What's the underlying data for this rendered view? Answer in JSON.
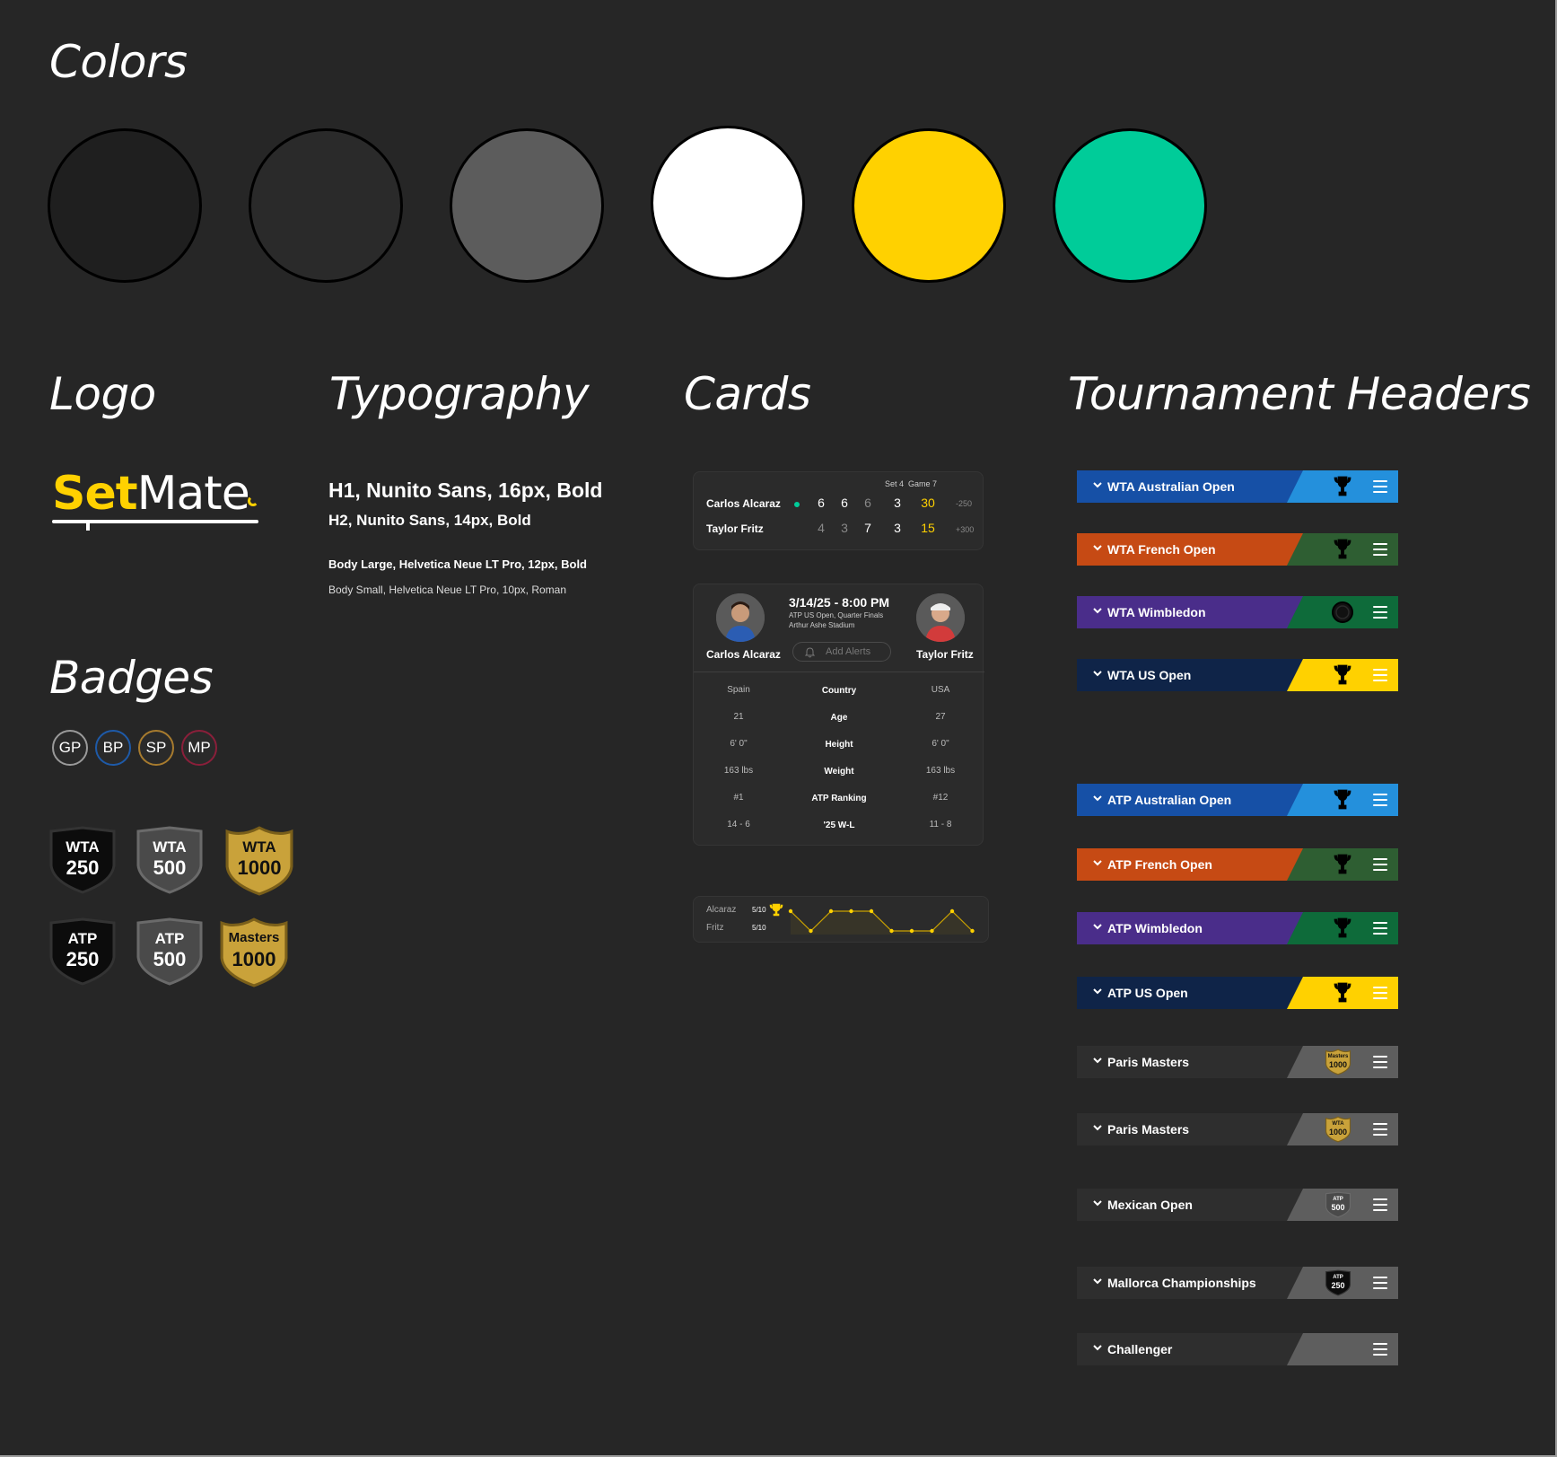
{
  "sections": {
    "colors": "Colors",
    "logo": "Logo",
    "typography": "Typography",
    "cards": "Cards",
    "tournament_headers": "Tournament Headers",
    "badges": "Badges"
  },
  "colors": [
    "#1f1f1f",
    "#2a2a2a",
    "#5c5c5c",
    "#ffffff",
    "#ffd100",
    "#00cc99"
  ],
  "logo": {
    "part1": "Set",
    "part2": "Mate"
  },
  "typography": {
    "h1": "H1, Nunito Sans, 16px, Bold",
    "h2": "H2, Nunito Sans, 14px, Bold",
    "body_large": "Body Large, Helvetica Neue LT Pro, 12px, Bold",
    "body_small": "Body Small, Helvetica Neue LT Pro, 10px, Roman"
  },
  "badges": {
    "circles": [
      {
        "label": "GP",
        "color": "#9a9a9a"
      },
      {
        "label": "BP",
        "color": "#1e5aa8"
      },
      {
        "label": "SP",
        "color": "#a77b2e"
      },
      {
        "label": "MP",
        "color": "#8a1f3a"
      }
    ],
    "shields": [
      {
        "top": "WTA",
        "bottom": "250",
        "tier": "black"
      },
      {
        "top": "WTA",
        "bottom": "500",
        "tier": "grey"
      },
      {
        "top": "WTA",
        "bottom": "1000",
        "tier": "gold"
      },
      {
        "top": "ATP",
        "bottom": "250",
        "tier": "black"
      },
      {
        "top": "ATP",
        "bottom": "500",
        "tier": "grey"
      },
      {
        "top": "Masters",
        "bottom": "1000",
        "tier": "gold"
      }
    ]
  },
  "score_card": {
    "set_label": "Set 4",
    "game_label": "Game 7",
    "player1": {
      "name": "Carlos Alcaraz",
      "sets": [
        "6",
        "6",
        "6",
        "3"
      ],
      "game": "30",
      "odds": "-250"
    },
    "player2": {
      "name": "Taylor Fritz",
      "sets": [
        "4",
        "3",
        "7",
        "3"
      ],
      "game": "15",
      "odds": "+300"
    }
  },
  "match_card": {
    "datetime": "3/14/25 - 8:00 PM",
    "event": "ATP US Open, Quarter Finals",
    "venue": "Arthur Ashe Stadium",
    "player1": "Carlos Alcaraz",
    "player2": "Taylor Fritz",
    "alerts_button": "Add Alerts",
    "stats": [
      {
        "left": "Spain",
        "label": "Country",
        "right": "USA"
      },
      {
        "left": "21",
        "label": "Age",
        "right": "27"
      },
      {
        "left": "6' 0\"",
        "label": "Height",
        "right": "6' 0\""
      },
      {
        "left": "163 lbs",
        "label": "Weight",
        "right": "163 lbs"
      },
      {
        "left": "#1",
        "label": "ATP Ranking",
        "right": "#12"
      },
      {
        "left": "14 - 6",
        "label": "'25 W-L",
        "right": "11 - 8"
      }
    ]
  },
  "momentum_card": {
    "player1": "Alcaraz",
    "player1_score": "5/10",
    "player2": "Fritz",
    "player2_score": "5/10",
    "points": [
      1,
      0,
      1,
      1,
      1,
      0,
      0,
      0,
      1,
      0
    ]
  },
  "tournament_headers": [
    {
      "label": "WTA Australian Open",
      "left": "#1650a6",
      "right": "#2490dc",
      "trophy": "trophy-icon"
    },
    {
      "label": "WTA French Open",
      "left": "#c64a14",
      "right": "#2e5e32",
      "trophy": "trophy-icon"
    },
    {
      "label": "WTA Wimbledon",
      "left": "#4a2d8a",
      "right": "#0e6b3a",
      "trophy": "plate-icon"
    },
    {
      "label": "WTA US Open",
      "left": "#0f2448",
      "right": "#ffd100",
      "trophy": "trophy-icon"
    },
    {
      "label": "ATP Australian Open",
      "left": "#1650a6",
      "right": "#2490dc",
      "trophy": "trophy-icon"
    },
    {
      "label": "ATP French Open",
      "left": "#c64a14",
      "right": "#2e5e32",
      "trophy": "trophy-icon"
    },
    {
      "label": "ATP Wimbledon",
      "left": "#4a2d8a",
      "right": "#0e6b3a",
      "trophy": "trophy-icon"
    },
    {
      "label": "ATP US Open",
      "left": "#0f2448",
      "right": "#ffd100",
      "trophy": "trophy-icon"
    },
    {
      "label": "Paris Masters",
      "left": "#2e2e2e",
      "right": "#5e5e5e",
      "badge_top": "Masters",
      "badge_bottom": "1000"
    },
    {
      "label": "Paris Masters",
      "left": "#2e2e2e",
      "right": "#5e5e5e",
      "badge_top": "WTA",
      "badge_bottom": "1000"
    },
    {
      "label": "Mexican Open",
      "left": "#2e2e2e",
      "right": "#5e5e5e",
      "badge_top": "ATP",
      "badge_bottom": "500"
    },
    {
      "label": "Mallorca Championships",
      "left": "#2e2e2e",
      "right": "#5e5e5e",
      "badge_top": "ATP",
      "badge_bottom": "250"
    },
    {
      "label": "Challenger",
      "left": "#2e2e2e",
      "right": "#5e5e5e"
    }
  ]
}
